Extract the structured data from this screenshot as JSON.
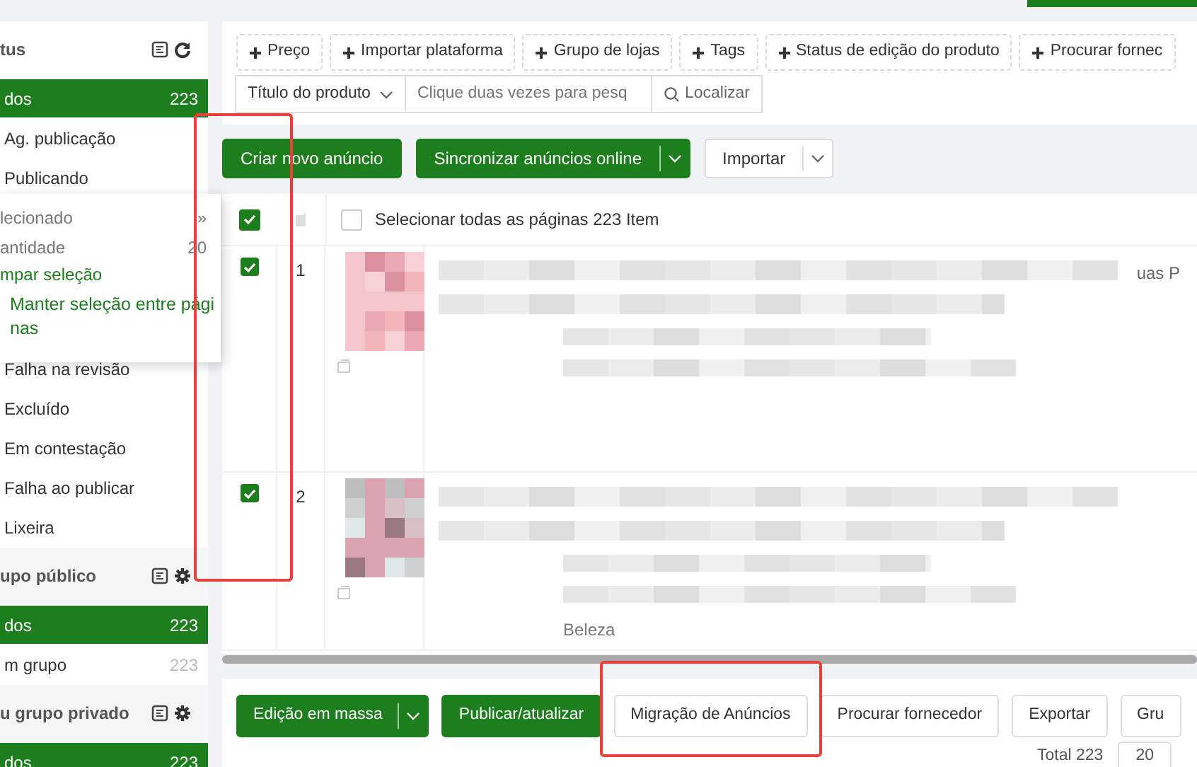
{
  "sidebar": {
    "sections": [
      {
        "title": "tus",
        "kind": "status",
        "items": [
          {
            "label": "dos",
            "count": "223",
            "selected": true
          },
          {
            "label": "Ag. publicação",
            "selected": false
          },
          {
            "label": "Publicando",
            "selected": false
          },
          {
            "label": "Falha na revisão",
            "selected": false
          },
          {
            "label": "Excluído",
            "selected": false
          },
          {
            "label": "Em contestação",
            "selected": false
          },
          {
            "label": "Falha ao publicar",
            "selected": false
          },
          {
            "label": "Lixeira",
            "selected": false
          }
        ]
      },
      {
        "title": "upo público",
        "kind": "group",
        "items": [
          {
            "label": "dos",
            "count": "223",
            "selected": true
          },
          {
            "label": "m grupo",
            "count": "223",
            "selected": false
          }
        ]
      },
      {
        "title": "u grupo privado",
        "kind": "group",
        "items": [
          {
            "label": "dos",
            "count": "223",
            "selected": true
          }
        ]
      }
    ]
  },
  "selection_popup": {
    "rows": [
      {
        "label": "lecionado",
        "value": "»"
      },
      {
        "label": "antidade",
        "value": "20"
      }
    ],
    "links": [
      "mpar seleção",
      "Manter seleção entre páginas"
    ]
  },
  "filters": [
    "Preço",
    "Importar plataforma",
    "Grupo de lojas",
    "Tags",
    "Status de edição do produto",
    "Procurar fornec"
  ],
  "search": {
    "field": "Título do produto",
    "placeholder": "Clique duas vezes para pesq",
    "button": "Localizar"
  },
  "actions": [
    {
      "label": "Criar novo anúncio",
      "kind": "primary"
    },
    {
      "label": "Sincronizar anúncios online",
      "kind": "primary-split"
    },
    {
      "label": "Importar",
      "kind": "split"
    }
  ],
  "table": {
    "header_checked": true,
    "checkbox_column_highlighted": true,
    "select_all": {
      "label": "Selecionar todas as páginas 223 Item",
      "checked": false
    },
    "rows": [
      {
        "checked": true,
        "number": "1",
        "side_text": "uas P"
      },
      {
        "checked": true,
        "number": "2",
        "note_text": "Beleza"
      }
    ]
  },
  "bottom_actions": [
    {
      "label": "Edição em massa",
      "kind": "primary-split",
      "highlighted": false
    },
    {
      "label": "Publicar/atualizar",
      "kind": "primary",
      "highlighted": false
    },
    {
      "label": "Migração de Anúncios",
      "kind": "plain",
      "highlighted": true
    },
    {
      "label": "Procurar fornecedor",
      "kind": "plain",
      "highlighted": false
    },
    {
      "label": "Exportar",
      "kind": "plain",
      "highlighted": false
    },
    {
      "label": "Gru",
      "kind": "plain",
      "highlighted": false
    }
  ],
  "pagination": {
    "total": "Total 223",
    "page_size": "20"
  }
}
